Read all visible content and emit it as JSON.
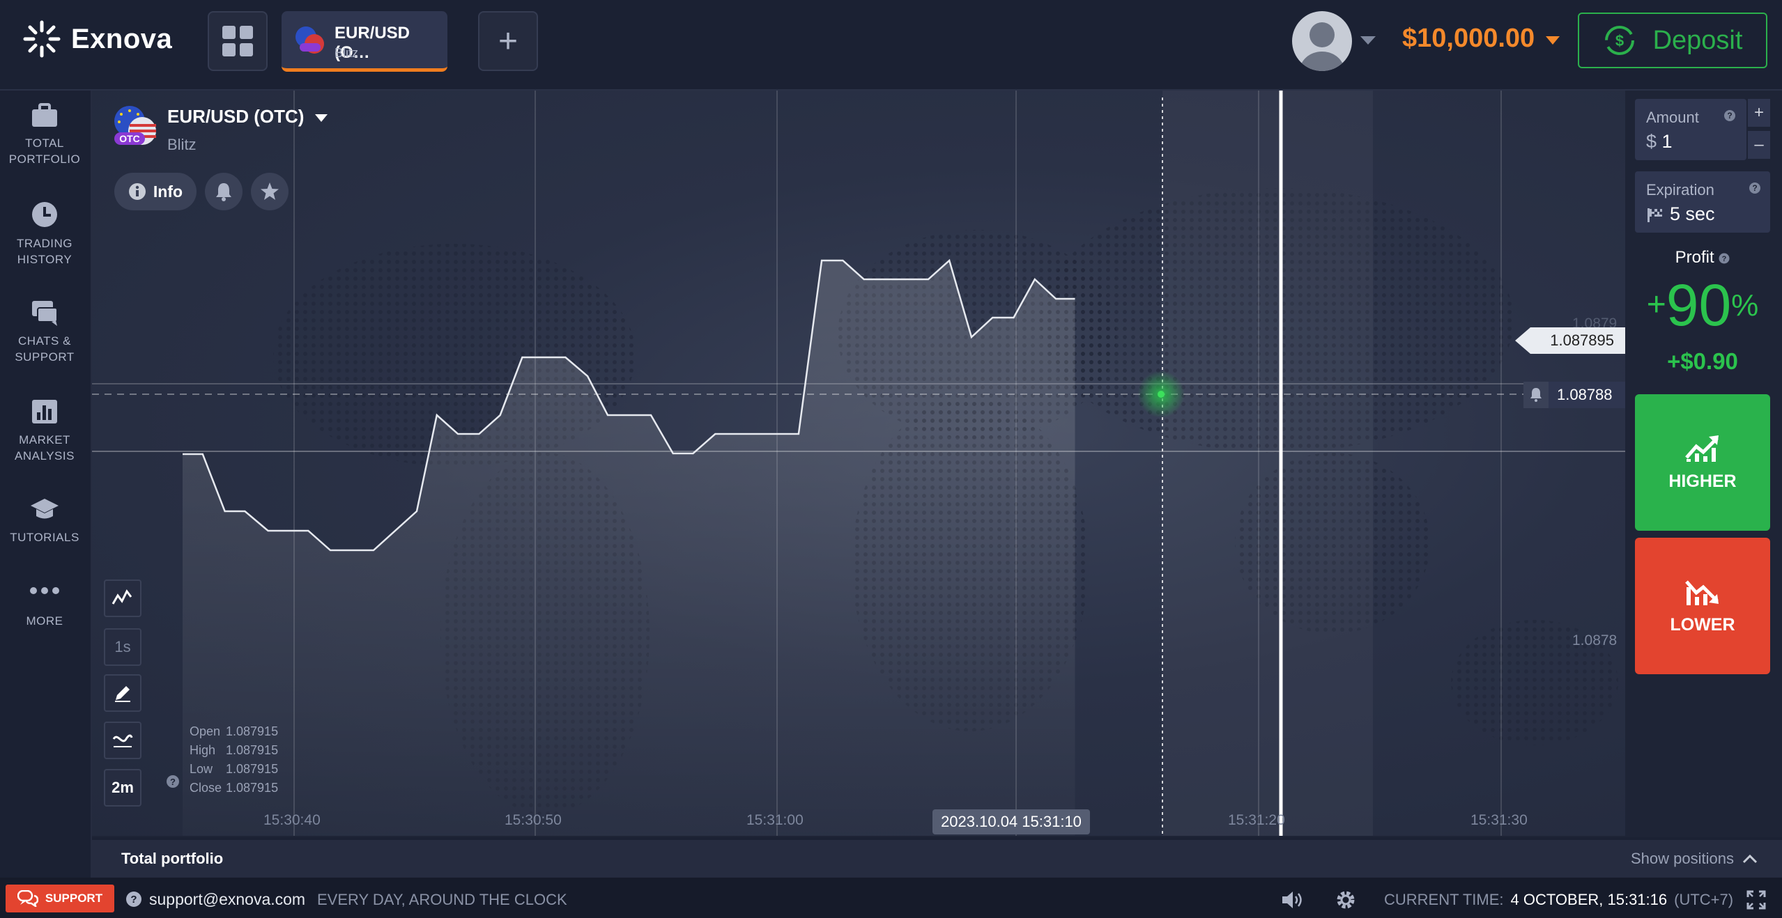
{
  "brand": {
    "name": "Exnova"
  },
  "topbar": {
    "asset_tab_title": "EUR/USD (O…",
    "asset_tab_sub": "Blitz",
    "add_label": "+",
    "balance": "$10,000.00",
    "deposit_label": "Deposit"
  },
  "sidebar": {
    "items": [
      {
        "line1": "TOTAL",
        "line2": "PORTFOLIO",
        "icon": "briefcase-icon"
      },
      {
        "line1": "TRADING",
        "line2": "HISTORY",
        "icon": "clock-icon"
      },
      {
        "line1": "CHATS &",
        "line2": "SUPPORT",
        "icon": "chat-icon"
      },
      {
        "line1": "MARKET",
        "line2": "ANALYSIS",
        "icon": "bar-chart-icon"
      },
      {
        "line1": "TUTORIALS",
        "line2": "",
        "icon": "graduation-cap-icon"
      },
      {
        "line1": "MORE",
        "line2": "",
        "icon": "more-dots-icon"
      }
    ]
  },
  "asset": {
    "name": "EUR/USD (OTC)",
    "sub": "Blitz",
    "badge": "OTC",
    "info_label": "Info"
  },
  "tools": {
    "timeframe": "1s",
    "period": "2m"
  },
  "ohlc": {
    "open_label": "Open",
    "open": "1.087915",
    "high_label": "High",
    "high": "1.087915",
    "low_label": "Low",
    "low": "1.087915",
    "close_label": "Close",
    "close": "1.087915"
  },
  "chart_data": {
    "type": "area",
    "x_ticks": [
      "15:30:40",
      "15:30:50",
      "15:31:00",
      "15:31:20",
      "15:31:30"
    ],
    "y_ticks": [
      "1.0879",
      "1.0878"
    ],
    "current_price": "1.087895",
    "alert_price": "1.08788",
    "crosshair_time": "2023.10.04 15:31:10",
    "points": [
      [
        0,
        522
      ],
      [
        20,
        522
      ],
      [
        42,
        604
      ],
      [
        62,
        604
      ],
      [
        85,
        632
      ],
      [
        125,
        632
      ],
      [
        147,
        660
      ],
      [
        190,
        660
      ],
      [
        233,
        604
      ],
      [
        253,
        466
      ],
      [
        274,
        493
      ],
      [
        295,
        493
      ],
      [
        316,
        466
      ],
      [
        338,
        383
      ],
      [
        381,
        383
      ],
      [
        403,
        410
      ],
      [
        423,
        466
      ],
      [
        466,
        466
      ],
      [
        488,
        521
      ],
      [
        508,
        521
      ],
      [
        530,
        493
      ],
      [
        613,
        493
      ],
      [
        636,
        244
      ],
      [
        657,
        244
      ],
      [
        678,
        271
      ],
      [
        742,
        271
      ],
      [
        763,
        244
      ],
      [
        785,
        354
      ],
      [
        806,
        326
      ],
      [
        827,
        326
      ],
      [
        848,
        271
      ],
      [
        869,
        299
      ],
      [
        888,
        299
      ]
    ]
  },
  "trade": {
    "amount_label": "Amount",
    "amount_currency": "$",
    "amount_value": "1",
    "expiration_label": "Expiration",
    "expiration_value": "5 sec",
    "profit_label": "Profit",
    "profit_sign": "+",
    "profit_pct": "90",
    "profit_pct_sym": "%",
    "profit_abs": "+$0.90",
    "higher_label": "HIGHER",
    "lower_label": "LOWER"
  },
  "portfolio_bar": {
    "title": "Total portfolio",
    "show_positions": "Show positions"
  },
  "footer": {
    "support_label": "SUPPORT",
    "email": "support@exnova.com",
    "hours": "EVERY DAY, AROUND THE CLOCK",
    "time_label": "CURRENT TIME:",
    "time_value": "4 OCTOBER, 15:31:16",
    "tz": "(UTC+7)"
  },
  "colors": {
    "accent": "#f5892b",
    "green": "#2bb04c",
    "red": "#e3442f",
    "bg": "#1e2436"
  }
}
